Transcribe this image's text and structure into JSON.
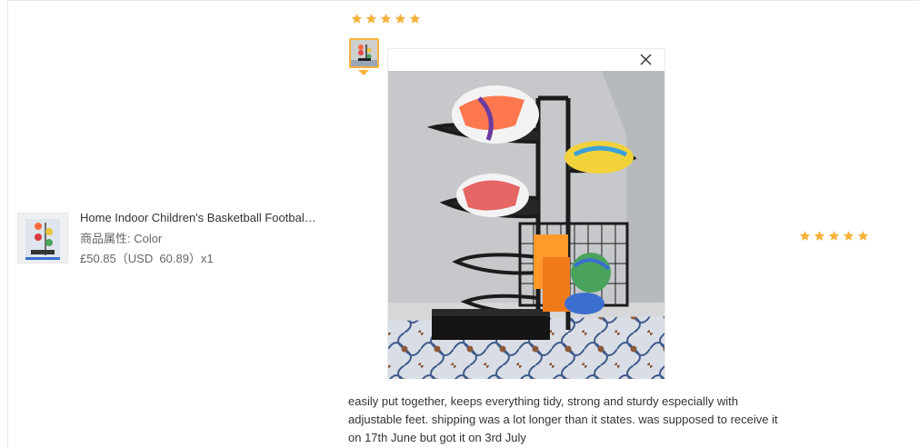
{
  "product": {
    "title": "Home Indoor Children's Basketball Football Storage Rack Sports Ball Holder",
    "attribute_label": "商品属性:",
    "attribute_value": "Color",
    "price": "£50.85（USD  60.89）x1"
  },
  "review": {
    "rating": 5,
    "text": "easily put together, keeps everything tidy, strong and sturdy especially with adjustable feet. shipping was a lot longer than it states. was supposed to receive it on 17th June but got it on 3rd July"
  },
  "right_rating": 5,
  "colors": {
    "star": "#f7b23b",
    "thumb_border": "#f7b23b"
  },
  "icons": {
    "close": "close-icon",
    "star": "star-icon"
  }
}
